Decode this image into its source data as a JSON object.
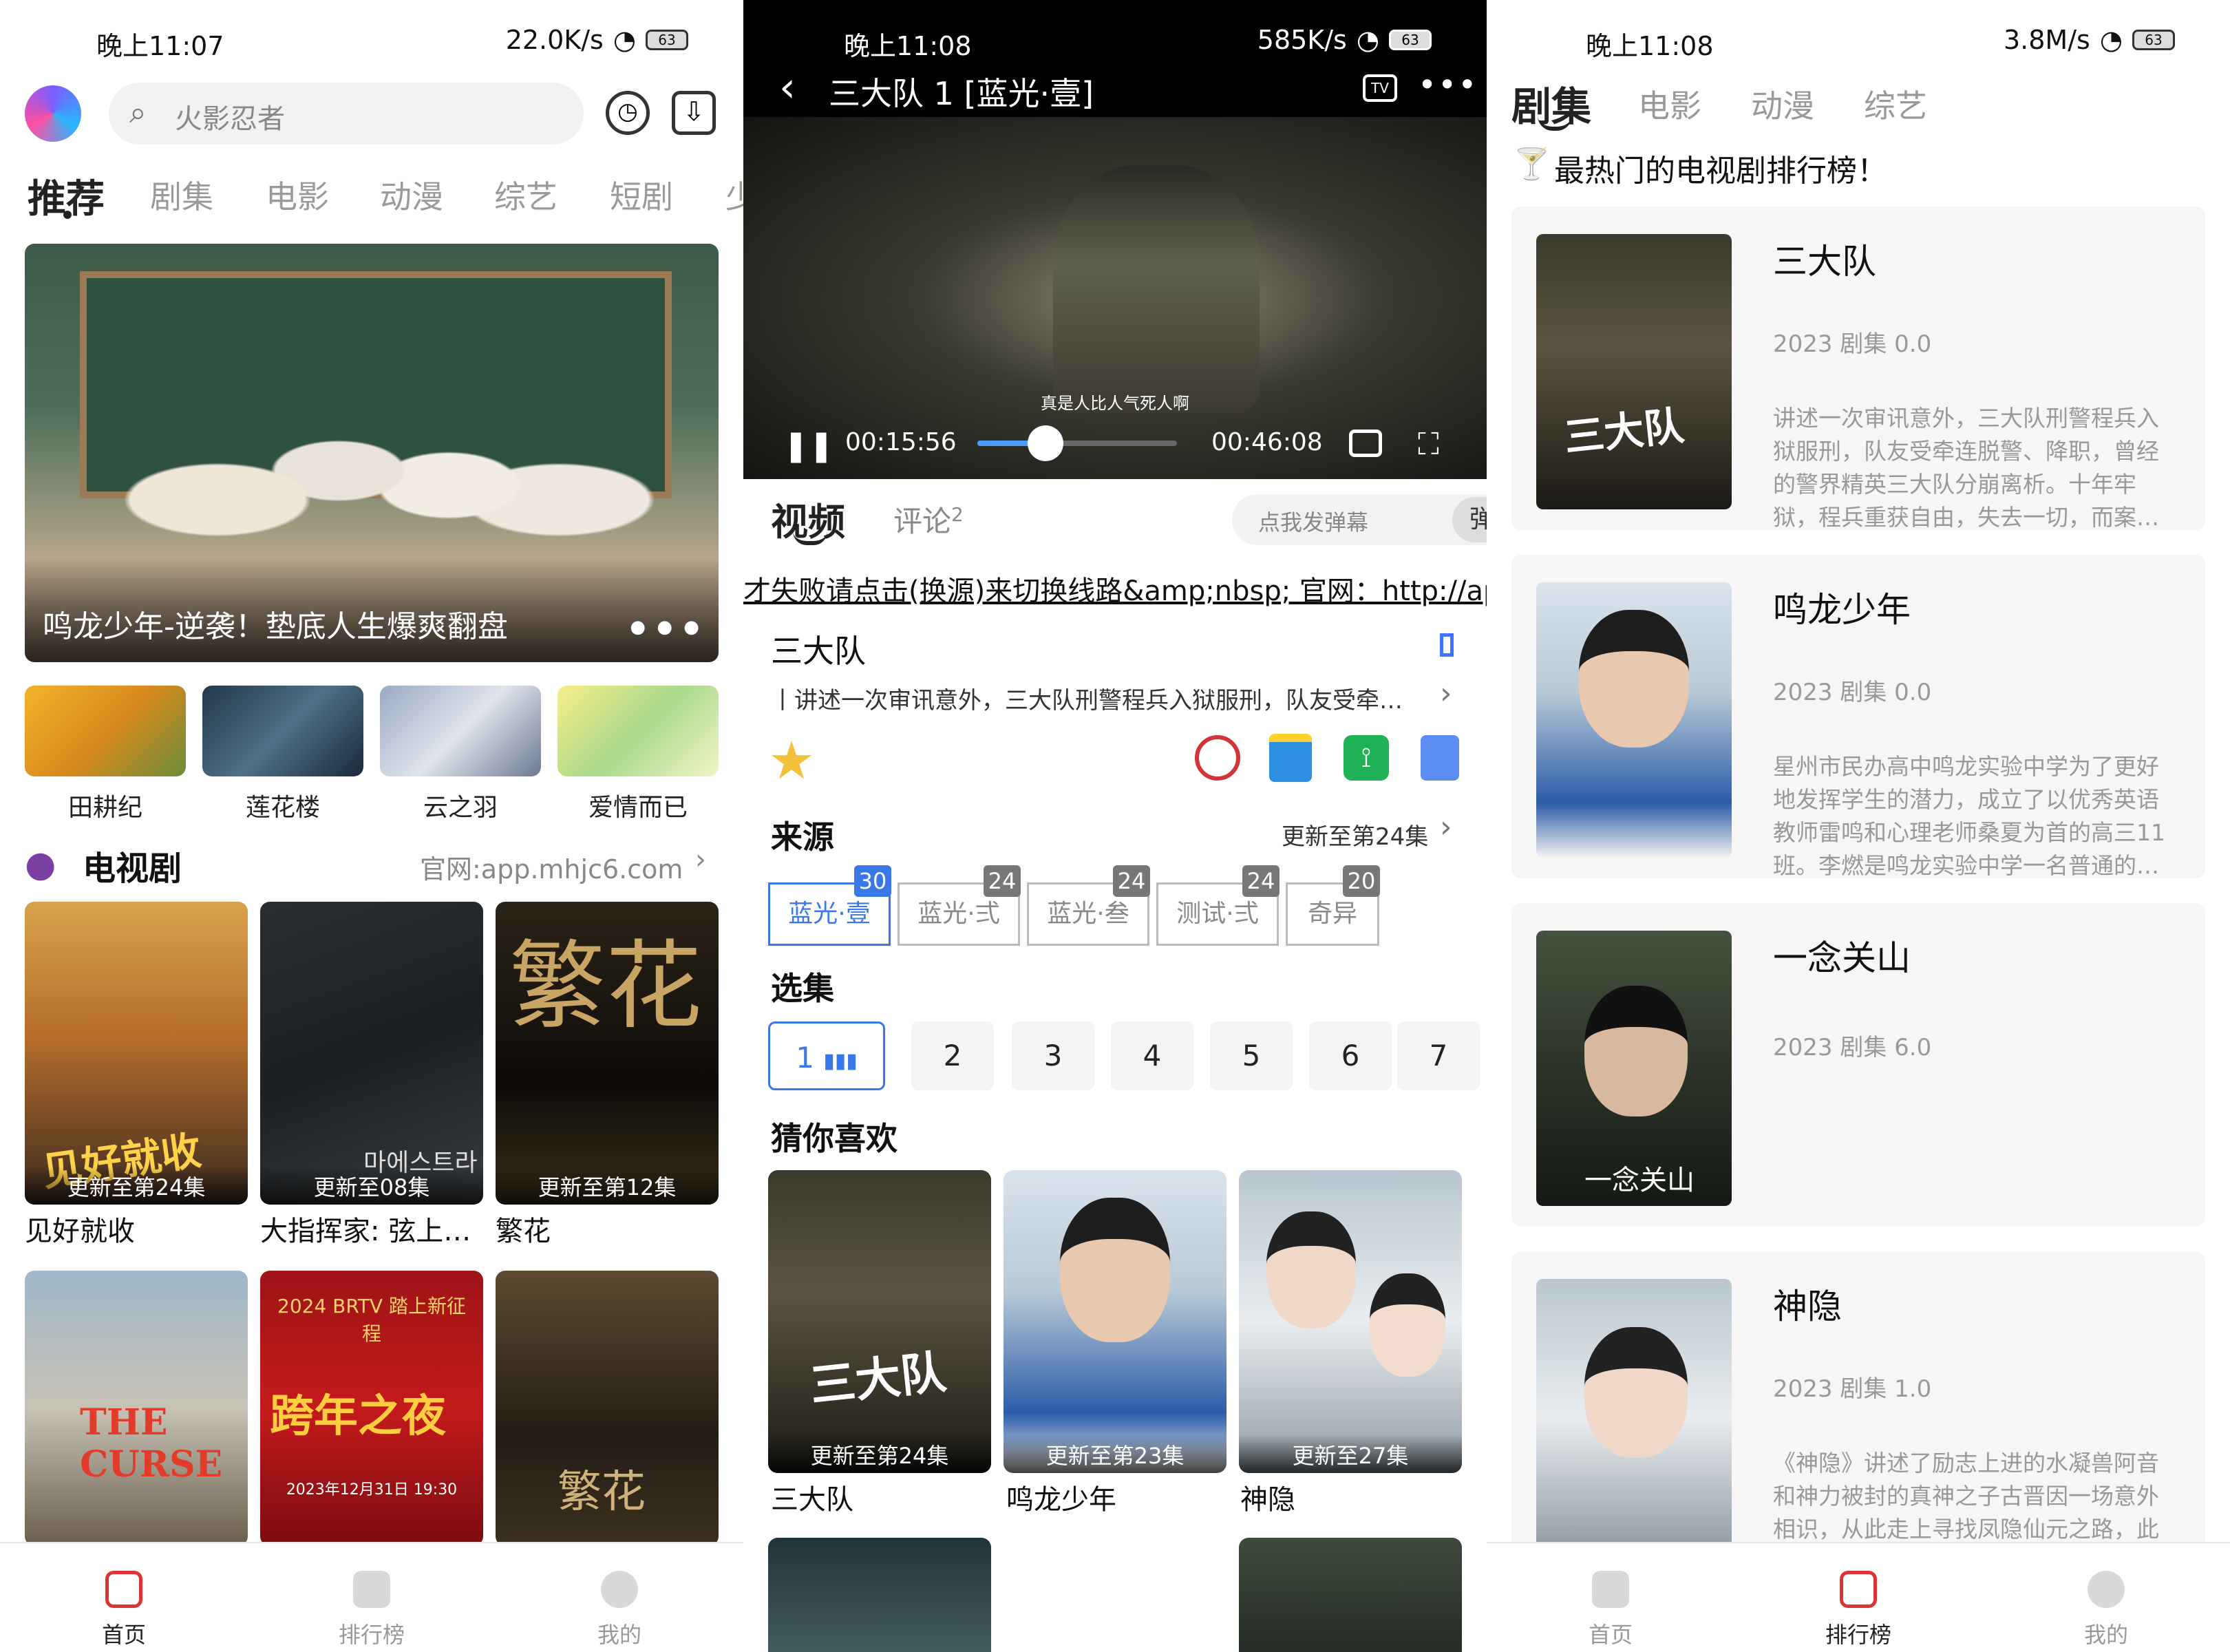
{
  "left": {
    "status": {
      "time": "晚上11:07",
      "speed": "22.0K/s",
      "battery": "63"
    },
    "search_placeholder": "火影忍者",
    "tabs": [
      "推荐",
      "剧集",
      "电影",
      "动漫",
      "综艺",
      "短剧",
      "少"
    ],
    "banner_title": "鸣龙少年-逆袭！垫底人生爆爽翻盘",
    "quick": [
      "田耕纪",
      "莲花楼",
      "云之羽",
      "爱情而已"
    ],
    "section_title": "电视剧",
    "section_link": "官网:app.mhjc6.com",
    "posters": [
      {
        "cap": "更新至第24集",
        "title": "见好就收",
        "art": "见好就收"
      },
      {
        "cap": "更新至08集",
        "title": "大指挥家: 弦上…",
        "art": "마에스트라"
      },
      {
        "cap": "更新至第12集",
        "title": "繁花",
        "art": "繁花"
      }
    ],
    "posters2": [
      {
        "art": "THE CURSE"
      },
      {
        "art": "跨年之夜",
        "art2": "2024 BRTV 踏上新征程",
        "art3": "2023年12月31日 19:30"
      },
      {
        "art": "繁花"
      }
    ],
    "bottom_tabs": [
      "首页",
      "排行榜",
      "我的"
    ]
  },
  "middle": {
    "status": {
      "time": "晚上11:08",
      "speed": "585K/s",
      "battery": "63"
    },
    "video_title": "三大队 1 [蓝光·壹]",
    "tv_label": "TV",
    "subtitle": "真是人比人气死人啊",
    "time_cur": "00:15:56",
    "time_total": "00:46:08",
    "progress": 0.34,
    "tab_video": "视频",
    "tab_comment": "评论",
    "comment_count": "2",
    "danmaku_placeholder": "点我发弹幕",
    "danmaku_btn": "弹",
    "notice": "才失败请点击(换源)来切换线路&amp;nbsp; 官网：http://ap",
    "show_title": "三大队",
    "show_desc": "丨讲述一次审讯意外，三大队刑警程兵入狱服刑，队友受牵…",
    "source_label": "来源",
    "source_update": "更新至第24集",
    "sources": [
      {
        "name": "蓝光·壹",
        "count": "30"
      },
      {
        "name": "蓝光·弍",
        "count": "24"
      },
      {
        "name": "蓝光·叁",
        "count": "24"
      },
      {
        "name": "测试·弍",
        "count": "24"
      },
      {
        "name": "奇异",
        "count": "20"
      }
    ],
    "episodes_label": "选集",
    "episodes": [
      "1",
      "2",
      "3",
      "4",
      "5",
      "6",
      "7"
    ],
    "guess_label": "猜你喜欢",
    "guess": [
      {
        "cap": "更新至第24集",
        "title": "三大队",
        "art": "三大队"
      },
      {
        "cap": "更新至第23集",
        "title": "鸣龙少年"
      },
      {
        "cap": "更新至27集",
        "title": "神隐"
      }
    ]
  },
  "right": {
    "status": {
      "time": "晚上11:08",
      "speed": "3.8M/s",
      "battery": "63"
    },
    "tabs": [
      "剧集",
      "电影",
      "动漫",
      "综艺"
    ],
    "headline": "最热门的电视剧排行榜！",
    "items": [
      {
        "name": "三大队",
        "meta": "2023 剧集 0.0",
        "desc": "讲述一次审讯意外，三大队刑警程兵入狱服刑，队友受牵连脱警、降职，曾经的警界精英三大队分崩离析。十年牢狱，程兵重获自由，失去一切，而案…",
        "art": "三大队"
      },
      {
        "name": "鸣龙少年",
        "meta": "2023 剧集 0.0",
        "desc": "星州市民办高中鸣龙实验中学为了更好地发挥学生的潜力，成立了以优秀英语教师雷鸣和心理老师桑夏为首的高三11班。李燃是鸣龙实验中学一名普通的…"
      },
      {
        "name": "一念关山",
        "meta": "2023 剧集 6.0",
        "desc": "",
        "art": "一念关山"
      },
      {
        "name": "神隐",
        "meta": "2023 剧集 1.0",
        "desc": "《神隐》讲述了励志上进的水凝兽阿音和神力被封的真神之子古晋因一场意外相识，从此走上寻找凤隐仙元之路，此"
      }
    ],
    "bottom_tabs": [
      "首页",
      "排行榜",
      "我的"
    ]
  }
}
